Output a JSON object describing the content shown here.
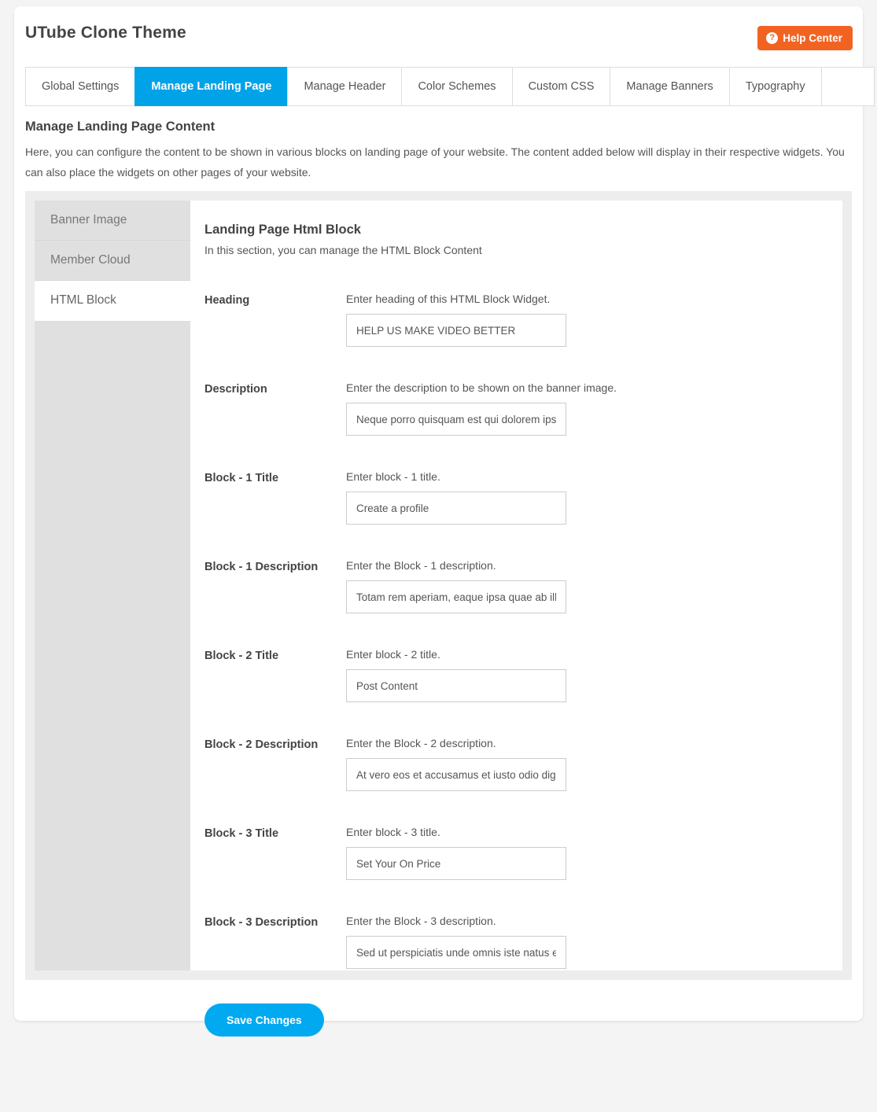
{
  "header": {
    "app_title": "UTube Clone Theme",
    "help_center_label": "Help Center",
    "help_icon": "question-mark-circle-icon"
  },
  "tabs": [
    {
      "label": "Global Settings",
      "active": false
    },
    {
      "label": "Manage Landing Page",
      "active": true
    },
    {
      "label": "Manage Header",
      "active": false
    },
    {
      "label": "Color Schemes",
      "active": false
    },
    {
      "label": "Custom CSS",
      "active": false
    },
    {
      "label": "Manage Banners",
      "active": false
    },
    {
      "label": "Typography",
      "active": false
    },
    {
      "label": "",
      "active": false
    }
  ],
  "section": {
    "title": "Manage Landing Page Content",
    "description": "Here, you can configure the content to be shown in various blocks on landing page of your website. The content added below will display in their respective widgets. You can also place the widgets on other pages of your website."
  },
  "sidebar": {
    "items": [
      {
        "label": "Banner Image",
        "active": false
      },
      {
        "label": "Member Cloud",
        "active": false
      },
      {
        "label": "HTML Block",
        "active": true
      }
    ]
  },
  "block": {
    "title": "Landing Page Html Block",
    "subtitle": "In this section, you can manage the HTML Block Content"
  },
  "form": {
    "rows": [
      {
        "label": "Heading",
        "help": "Enter heading of this HTML Block Widget.",
        "value": "HELP US MAKE VIDEO BETTER"
      },
      {
        "label": "Description",
        "help": "Enter the description to be shown on the banner image.",
        "value": "Neque porro quisquam est qui dolorem ipsum"
      },
      {
        "label": "Block - 1 Title",
        "help": "Enter block - 1 title.",
        "value": "Create a profile"
      },
      {
        "label": "Block - 1 Description",
        "help": "Enter the Block - 1 description.",
        "value": "Totam rem aperiam, eaque ipsa quae ab illo"
      },
      {
        "label": "Block - 2 Title",
        "help": "Enter block - 2 title.",
        "value": "Post Content"
      },
      {
        "label": "Block - 2 Description",
        "help": "Enter the Block - 2 description.",
        "value": "At vero eos et accusamus et iusto odio dignissimos"
      },
      {
        "label": "Block - 3 Title",
        "help": "Enter block - 3 title.",
        "value": "Set Your On Price"
      },
      {
        "label": "Block - 3 Description",
        "help": "Enter the Block - 3 description.",
        "value": "Sed ut perspiciatis unde omnis iste natus error"
      }
    ],
    "save_label": "Save Changes"
  },
  "colors": {
    "accent_blue": "#00a2e8",
    "help_orange": "#f26322",
    "save_blue": "#00a9f0",
    "panel_grey": "#ededed",
    "sidebar_grey": "#e0e0e0"
  }
}
